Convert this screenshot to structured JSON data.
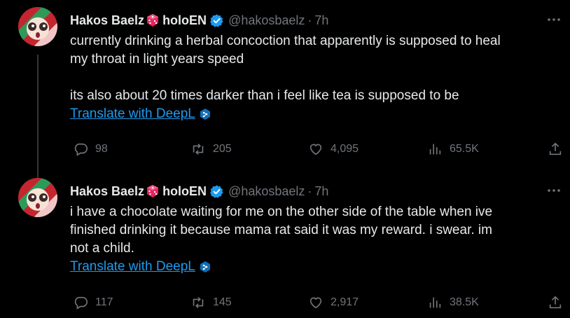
{
  "tweets": [
    {
      "author_name": "Hakos Baelz",
      "author_suffix": "holoEN",
      "handle": "@hakosbaelz",
      "dot": "·",
      "time": "7h",
      "lines": [
        "currently drinking a herbal concoction that apparently is supposed to heal",
        "my throat in light years speed",
        "",
        "its also about 20 times darker than i feel like tea is supposed to be"
      ],
      "translate_label": "Translate with DeepL",
      "replies": "98",
      "retweets": "205",
      "likes": "4,095",
      "views": "65.5K"
    },
    {
      "author_name": "Hakos Baelz",
      "author_suffix": "holoEN",
      "handle": "@hakosbaelz",
      "dot": "·",
      "time": "7h",
      "lines": [
        "i have a chocolate waiting for me on the other side of the table when ive",
        "finished drinking it because mama rat said it was my reward.  i swear. im",
        "not a child."
      ],
      "translate_label": "Translate with DeepL",
      "replies": "117",
      "retweets": "145",
      "likes": "2,917",
      "views": "38.5K"
    }
  ],
  "colors": {
    "background": "#000000",
    "text": "#e7e9ea",
    "muted": "#71767b",
    "link": "#1d9bf0",
    "verified": "#1d9bf0",
    "dice": "#e0245e"
  },
  "icons": [
    "reply-icon",
    "retweet-icon",
    "like-icon",
    "views-icon",
    "share-icon",
    "more-icon",
    "verified-badge-icon",
    "dice-icon",
    "deepl-icon"
  ]
}
